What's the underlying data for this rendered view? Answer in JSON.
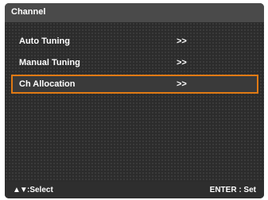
{
  "header": {
    "title": "Channel"
  },
  "menu": {
    "items": [
      {
        "label": "Auto Tuning",
        "arrow": ">>",
        "selected": false
      },
      {
        "label": "Manual Tuning",
        "arrow": ">>",
        "selected": false
      },
      {
        "label": "Ch Allocation",
        "arrow": ">>",
        "selected": true
      }
    ]
  },
  "footer": {
    "nav_icon": "▲▼",
    "nav_label": ":Select",
    "enter_label": "ENTER : Set"
  },
  "colors": {
    "highlight_border": "#e07a14",
    "panel_bg": "#2e2e2e",
    "header_bg": "#4a4a4a",
    "text": "#ffffff"
  }
}
